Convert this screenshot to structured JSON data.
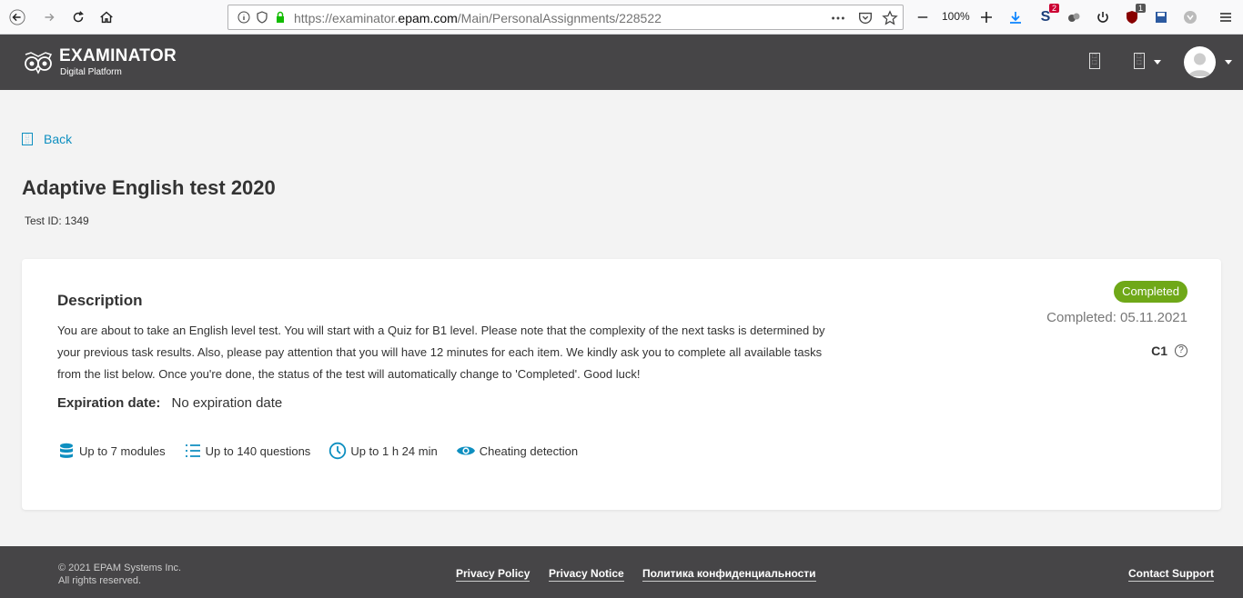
{
  "browser": {
    "url_prefix": "https://examinator.",
    "url_domain": "epam.com",
    "url_path": "/Main/PersonalAssignments/228522",
    "zoom": "100%",
    "ext_badge_1": "2",
    "ext_badge_2": "1"
  },
  "header": {
    "logo_title": "EXAMINATOR",
    "logo_subtitle": "Digital Platform"
  },
  "page": {
    "back_label": "Back",
    "title": "Adaptive English test 2020",
    "test_id": "Test ID: 1349"
  },
  "card": {
    "description_title": "Description",
    "description_text": "You are about to take an English level test. You will start with a Quiz for B1 level. Please note that the complexity of the next tasks is determined by your previous task results. Also, please pay attention that you will have 12 minutes for each item. We kindly ask you to complete all available tasks from the list below. Once you're done, the status of the test will automatically change to 'Completed'. Good luck!",
    "expiration_label": "Expiration date:",
    "expiration_value": "No expiration date",
    "status": "Completed",
    "completed_date": "Completed: 05.11.2021",
    "level": "C1",
    "help_glyph": "?",
    "features": [
      {
        "label": "Up to 7 modules",
        "icon": "database-icon"
      },
      {
        "label": "Up to 140 questions",
        "icon": "list-icon"
      },
      {
        "label": "Up to 1 h 24 min",
        "icon": "clock-icon"
      },
      {
        "label": "Cheating detection",
        "icon": "eye-icon"
      }
    ]
  },
  "footer": {
    "copyright_line1": "© 2021 EPAM Systems Inc.",
    "copyright_line2": "All rights reserved.",
    "links": [
      "Privacy Policy",
      "Privacy Notice",
      "Политика конфиденциальности",
      "Contact Support"
    ]
  },
  "colors": {
    "header_bg": "#464547",
    "accent": "#0e8fc0",
    "status_green": "#6fa818"
  }
}
